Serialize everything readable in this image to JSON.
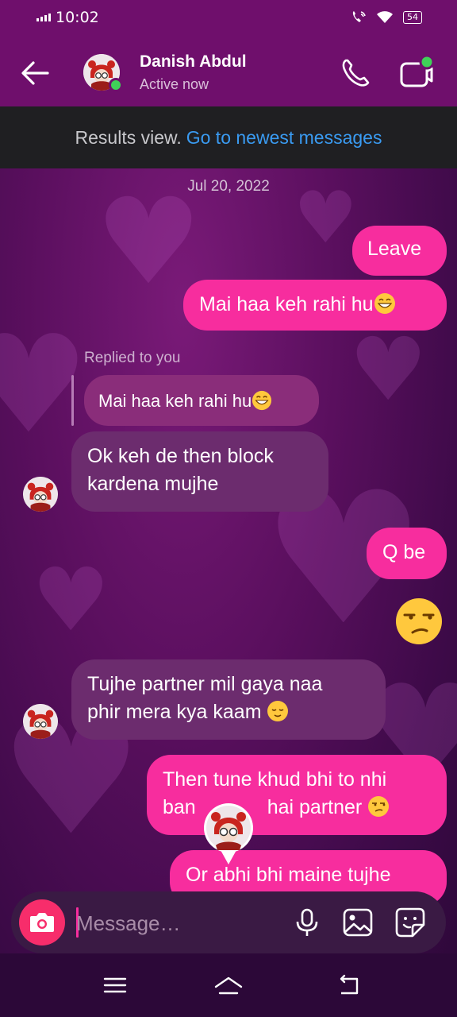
{
  "status": {
    "time": "10:02",
    "battery": "54"
  },
  "header": {
    "name": "Danish Abdul",
    "activity": "Active now"
  },
  "results": {
    "label": "Results view.",
    "link": "Go to newest messages"
  },
  "date_divider": "Jul 20, 2022",
  "messages": {
    "m1": "Leave",
    "m2": "Mai haa keh rahi hu",
    "replied_label": "Replied to you",
    "m3_quote": "Mai haa keh rahi hu",
    "m4_line1": "Ok keh de then block",
    "m4_line2": "kardena mujhe",
    "m5": "Q be",
    "m7_line1": "Tujhe partner mil gaya naa",
    "m7_line2": "phir mera kya kaam",
    "m8_line1": "Then tune khud bhi to nhi",
    "m8_line2": "ban",
    "m8_line2b": "hai partner",
    "m9": "Or abhi bhi maine tujhe"
  },
  "composer": {
    "placeholder": "Message…"
  },
  "icons": {
    "back": "arrow-left-icon",
    "call": "phone-icon",
    "video": "video-camera-icon",
    "camera": "camera-icon",
    "mic": "microphone-icon",
    "gallery": "image-icon",
    "sticker": "sticker-icon",
    "nav_menu": "menu-icon",
    "nav_home": "home-icon",
    "nav_back": "back-icon"
  },
  "colors": {
    "outgoing_bubble": "#f72d9e",
    "incoming_bubble": "#6c2c6e",
    "link": "#3a9bf2",
    "online": "#3fd158"
  }
}
